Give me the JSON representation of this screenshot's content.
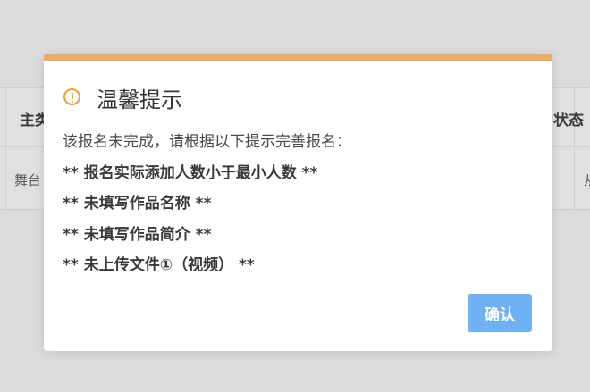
{
  "background_table": {
    "header_left": "主类",
    "header_right": "状态",
    "cell_left": "舞台",
    "cell_right": "从"
  },
  "dialog": {
    "title": "温馨提示",
    "intro": "该报名未完成，请根据以下提示完善报名：",
    "messages": [
      "** 报名实际添加人数小于最小人数 **",
      "** 未填写作品名称 **",
      "** 未填写作品简介 **",
      "** 未上传文件①（视频） **"
    ],
    "confirm_label": "确认"
  },
  "colors": {
    "accent_warning": "#e6a23c",
    "top_bar": "#e8ad6a",
    "confirm_button": "#6fb1f2",
    "overlay": "#dcdcdc"
  },
  "icons": {
    "title_icon": "warning-circle-icon"
  }
}
